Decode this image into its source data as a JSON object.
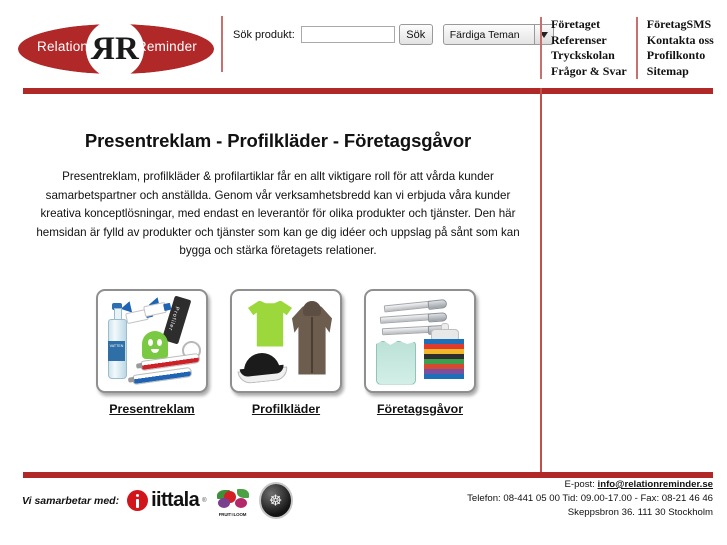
{
  "header": {
    "logo": {
      "left_word": "Relation",
      "right_word": "Reminder",
      "monogram_mirrored": "R",
      "monogram": "R",
      "lens_color": "#b02828"
    },
    "search": {
      "label": "Sök produkt:",
      "input_value": "",
      "input_placeholder": "",
      "button_label": "Sök",
      "theme_select_value": "Färdiga Teman"
    },
    "nav": {
      "column_one": [
        {
          "label": "Företaget"
        },
        {
          "label": "Referenser"
        },
        {
          "label": "Tryckskolan"
        },
        {
          "label": "Frågor & Svar"
        }
      ],
      "column_two": [
        {
          "label": "FöretagSMS"
        },
        {
          "label": "Kontakta oss"
        },
        {
          "label": "Profilkonto"
        },
        {
          "label": "Sitemap"
        }
      ]
    }
  },
  "main": {
    "title": "Presentreklam - Profilkläder - Företagsgåvor",
    "intro": "Presentreklam, profilkläder & profilartiklar får en allt viktigare roll för att vårda kunder samarbetspartner och anställda. Genom vår verksamhetsbredd kan vi erbjuda våra kunder kreativa konceptlösningar, med endast en leverantör för olika produkter och tjänster. Den här hemsidan är fylld av produkter och tjänster som kan ge dig idéer och uppslag på sånt som kan bygga och stärka företagets relationer.",
    "categories": [
      {
        "label": "Presentreklam"
      },
      {
        "label": "Profilkläder"
      },
      {
        "label": "Företagsgåvor"
      }
    ]
  },
  "footer": {
    "partners_label": "Vi samarbetar med:",
    "partners": [
      {
        "name": "iittala",
        "wordmark": "iittala",
        "trademark": "®"
      },
      {
        "name": "fruit-of-the-loom",
        "wordmark": "FRUIT≡LOOM"
      },
      {
        "name": "badge-logo",
        "glyph": "☸"
      }
    ],
    "contact": {
      "email_label": "E-post:",
      "email": "info@relationreminder.se",
      "phone_line": "Telefon: 08-441 05 00 Tid: 09.00-17.00 - Fax: 08-21 46 46",
      "address_line": "Skeppsbron 36. 111 30 Stockholm"
    }
  },
  "theme": {
    "red": "#b02828",
    "rule_red": "#c0504a",
    "text": "#111111"
  }
}
